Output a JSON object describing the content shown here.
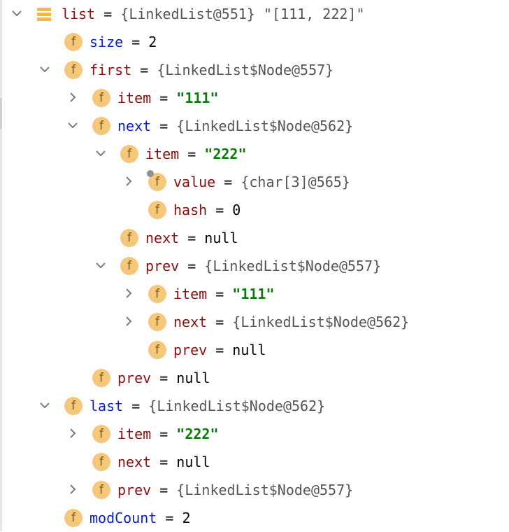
{
  "rows": [
    {
      "name": "list",
      "name_color": "red",
      "value": "{LinkedList@551} \"[111, 222]\"",
      "value_type": "ref",
      "toggle": "expanded",
      "icon": "list-icon",
      "level": 0
    },
    {
      "name": "size",
      "name_color": "blue",
      "value": "2",
      "value_type": "num",
      "toggle": "none",
      "icon": "field-icon",
      "level": 1
    },
    {
      "name": "first",
      "name_color": "red",
      "value": "{LinkedList$Node@557}",
      "value_type": "ref",
      "toggle": "expanded",
      "icon": "field-icon",
      "level": 1
    },
    {
      "name": "item",
      "name_color": "red",
      "value": "\"111\"",
      "value_type": "str",
      "toggle": "collapsed",
      "icon": "field-icon",
      "level": 2
    },
    {
      "name": "next",
      "name_color": "blue",
      "value": "{LinkedList$Node@562}",
      "value_type": "ref",
      "toggle": "expanded",
      "icon": "field-icon",
      "level": 2
    },
    {
      "name": "item",
      "name_color": "red",
      "value": "\"222\"",
      "value_type": "str",
      "toggle": "expanded",
      "icon": "field-icon",
      "level": 3
    },
    {
      "name": "value",
      "name_color": "red",
      "value": "{char[3]@565}",
      "value_type": "ref",
      "toggle": "collapsed",
      "icon": "field-icon",
      "level": 4,
      "badge": "lock"
    },
    {
      "name": "hash",
      "name_color": "red",
      "value": "0",
      "value_type": "num",
      "toggle": "none",
      "icon": "field-icon",
      "level": 4
    },
    {
      "name": "next",
      "name_color": "red",
      "value": "null",
      "value_type": "plain",
      "toggle": "none",
      "icon": "field-icon",
      "level": 3
    },
    {
      "name": "prev",
      "name_color": "red",
      "value": "{LinkedList$Node@557}",
      "value_type": "ref",
      "toggle": "expanded",
      "icon": "field-icon",
      "level": 3
    },
    {
      "name": "item",
      "name_color": "red",
      "value": "\"111\"",
      "value_type": "str",
      "toggle": "collapsed",
      "icon": "field-icon",
      "level": 4
    },
    {
      "name": "next",
      "name_color": "red",
      "value": "{LinkedList$Node@562}",
      "value_type": "ref",
      "toggle": "collapsed",
      "icon": "field-icon",
      "level": 4
    },
    {
      "name": "prev",
      "name_color": "red",
      "value": "null",
      "value_type": "plain",
      "toggle": "none",
      "icon": "field-icon",
      "level": 4
    },
    {
      "name": "prev",
      "name_color": "red",
      "value": "null",
      "value_type": "plain",
      "toggle": "none",
      "icon": "field-icon",
      "level": 2
    },
    {
      "name": "last",
      "name_color": "blue",
      "value": "{LinkedList$Node@562}",
      "value_type": "ref",
      "toggle": "expanded",
      "icon": "field-icon",
      "level": 1
    },
    {
      "name": "item",
      "name_color": "red",
      "value": "\"222\"",
      "value_type": "str",
      "toggle": "collapsed",
      "icon": "field-icon",
      "level": 2
    },
    {
      "name": "next",
      "name_color": "red",
      "value": "null",
      "value_type": "plain",
      "toggle": "none",
      "icon": "field-icon",
      "level": 2
    },
    {
      "name": "prev",
      "name_color": "red",
      "value": "{LinkedList$Node@557}",
      "value_type": "ref",
      "toggle": "collapsed",
      "icon": "field-icon",
      "level": 2
    },
    {
      "name": "modCount",
      "name_color": "blue",
      "value": "2",
      "value_type": "num",
      "toggle": "none",
      "icon": "field-icon",
      "level": 1
    }
  ],
  "icon_letter": "f",
  "equals_sign": "=",
  "colors": {
    "field_icon_bg": "#f5c77b",
    "name_blue": "#0c1ec4",
    "name_red": "#8a1010",
    "string_green": "#0a7a0a",
    "ref_gray": "#555555"
  }
}
